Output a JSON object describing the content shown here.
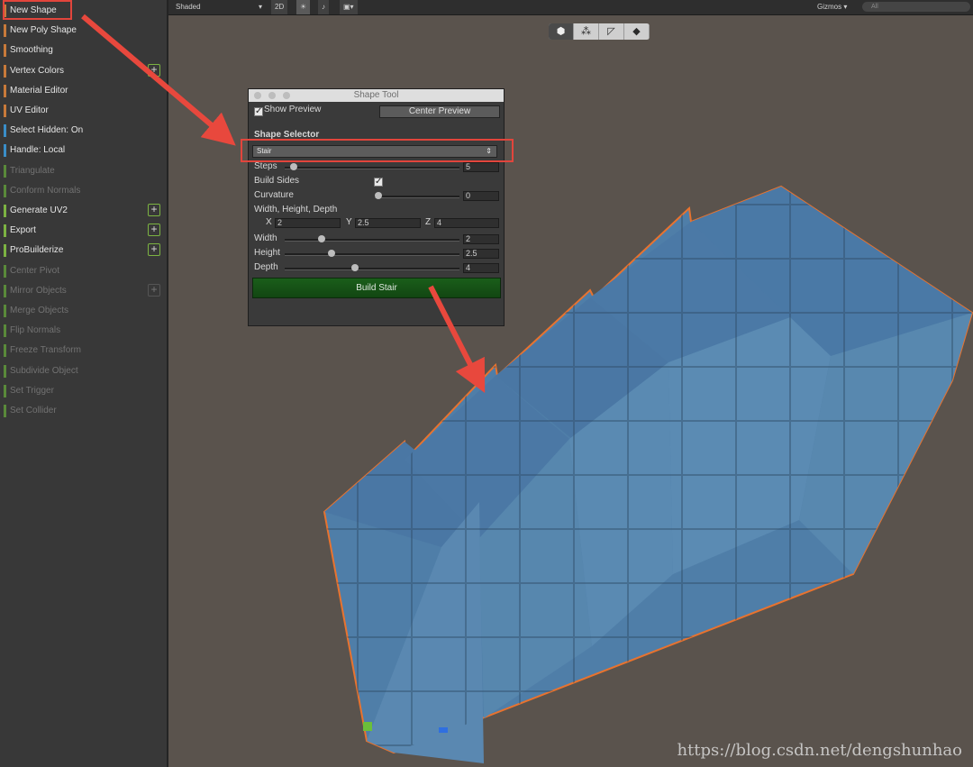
{
  "sidebar": {
    "items": [
      {
        "label": "New Shape",
        "color": "#c87a3a",
        "enabled": true,
        "plus": false
      },
      {
        "label": "New Poly Shape",
        "color": "#c87a3a",
        "enabled": true,
        "plus": false
      },
      {
        "label": "Smoothing",
        "color": "#c87a3a",
        "enabled": true,
        "plus": false
      },
      {
        "label": "Vertex Colors",
        "color": "#c87a3a",
        "enabled": true,
        "plus": true
      },
      {
        "label": "Material Editor",
        "color": "#c87a3a",
        "enabled": true,
        "plus": false
      },
      {
        "label": "UV Editor",
        "color": "#c87a3a",
        "enabled": true,
        "plus": false
      },
      {
        "label": "Select Hidden: On",
        "color": "#3a8ec8",
        "enabled": true,
        "plus": false
      },
      {
        "label": "Handle: Local",
        "color": "#3a8ec8",
        "enabled": true,
        "plus": false
      },
      {
        "label": "Triangulate",
        "color": "#5a8a3a",
        "enabled": false,
        "plus": false
      },
      {
        "label": "Conform Normals",
        "color": "#5a8a3a",
        "enabled": false,
        "plus": false
      },
      {
        "label": "Generate UV2",
        "color": "#7cb342",
        "enabled": true,
        "plus": true
      },
      {
        "label": "Export",
        "color": "#7cb342",
        "enabled": true,
        "plus": true
      },
      {
        "label": "ProBuilderize",
        "color": "#7cb342",
        "enabled": true,
        "plus": true
      },
      {
        "label": "Center Pivot",
        "color": "#5a8a3a",
        "enabled": false,
        "plus": false
      },
      {
        "label": "Mirror Objects",
        "color": "#5a8a3a",
        "enabled": false,
        "plus": true
      },
      {
        "label": "Merge Objects",
        "color": "#5a8a3a",
        "enabled": false,
        "plus": false
      },
      {
        "label": "Flip Normals",
        "color": "#5a8a3a",
        "enabled": false,
        "plus": false
      },
      {
        "label": "Freeze Transform",
        "color": "#5a8a3a",
        "enabled": false,
        "plus": false
      },
      {
        "label": "Subdivide Object",
        "color": "#5a8a3a",
        "enabled": false,
        "plus": false
      },
      {
        "label": "Set Trigger",
        "color": "#5a8a3a",
        "enabled": false,
        "plus": false
      },
      {
        "label": "Set Collider",
        "color": "#5a8a3a",
        "enabled": false,
        "plus": false
      }
    ]
  },
  "toolbar": {
    "shading_mode": "Shaded",
    "mode_2d": "2D",
    "gizmos": "Gizmos",
    "search_placeholder": "All"
  },
  "shape_tool": {
    "title": "Shape Tool",
    "show_preview_label": "Show Preview",
    "show_preview_checked": true,
    "center_preview_label": "Center Preview",
    "shape_selector_label": "Shape Selector",
    "shape_selected": "Stair",
    "steps_label": "Steps",
    "steps_value": "5",
    "steps_fraction": 0.03,
    "build_sides_label": "Build Sides",
    "build_sides_checked": true,
    "curvature_label": "Curvature",
    "curvature_value": "0",
    "curvature_fraction": 0.0,
    "whd_label": "Width, Height, Depth",
    "x_label": "X",
    "x_value": "2",
    "y_label": "Y",
    "y_value": "2.5",
    "z_label": "Z",
    "z_value": "4",
    "width_label": "Width",
    "width_value": "2",
    "width_fraction": 0.2,
    "height_label": "Height",
    "height_value": "2.5",
    "height_fraction": 0.26,
    "depth_label": "Depth",
    "depth_value": "4",
    "depth_fraction": 0.4,
    "build_button_label": "Build Stair"
  },
  "colors": {
    "highlight": "#e2453c",
    "stair_top": "#4a78a6",
    "stair_front": "#5a88b0",
    "stair_outline": "#e8732f",
    "build_button": "#1a5e1a"
  },
  "watermark": "https://blog.csdn.net/dengshunhao"
}
